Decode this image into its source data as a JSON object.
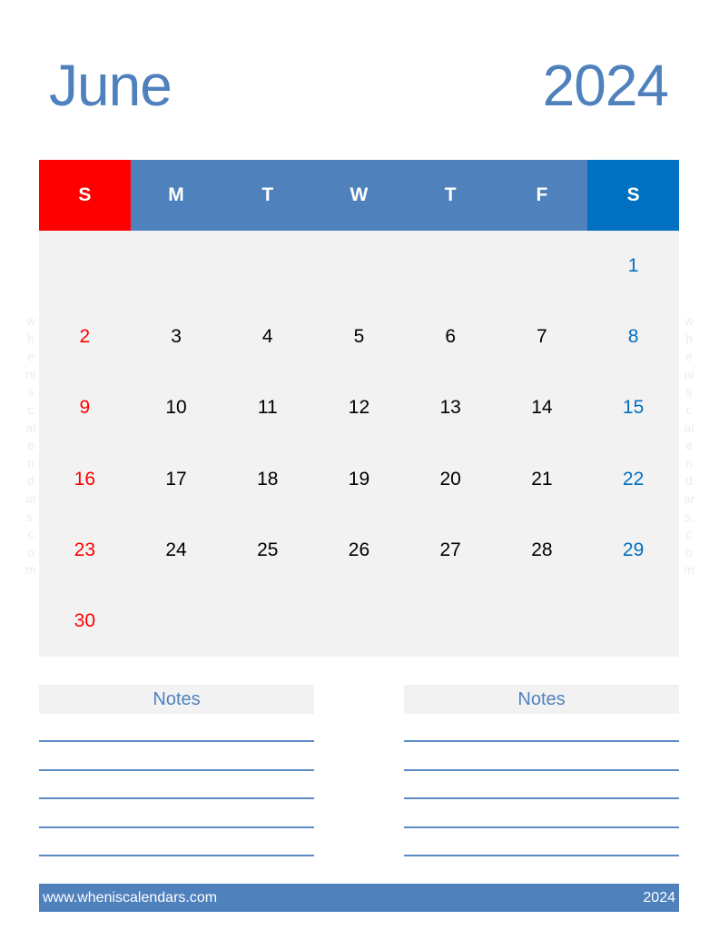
{
  "header": {
    "month": "June",
    "year": "2024"
  },
  "weekdays": [
    "S",
    "M",
    "T",
    "W",
    "T",
    "F",
    "S"
  ],
  "weeks": [
    [
      "",
      "",
      "",
      "",
      "",
      "",
      "1"
    ],
    [
      "2",
      "3",
      "4",
      "5",
      "6",
      "7",
      "8"
    ],
    [
      "9",
      "10",
      "11",
      "12",
      "13",
      "14",
      "15"
    ],
    [
      "16",
      "17",
      "18",
      "19",
      "20",
      "21",
      "22"
    ],
    [
      "23",
      "24",
      "25",
      "26",
      "27",
      "28",
      "29"
    ],
    [
      "30",
      "",
      "",
      "",
      "",
      "",
      ""
    ]
  ],
  "watermark": [
    "w",
    "h",
    "e",
    "ni",
    "s",
    "c",
    "al",
    "e",
    "n",
    "d",
    "ar",
    "s.",
    "c",
    "o",
    "m"
  ],
  "notes": [
    {
      "title": "Notes"
    },
    {
      "title": "Notes"
    }
  ],
  "footer": {
    "website": "www.wheniscalendars.com",
    "year": "2024"
  },
  "colors": {
    "accent": "#4f81bd",
    "sunday": "#ff0000",
    "saturday": "#0070c0",
    "grid_bg": "#f2f2f2"
  }
}
